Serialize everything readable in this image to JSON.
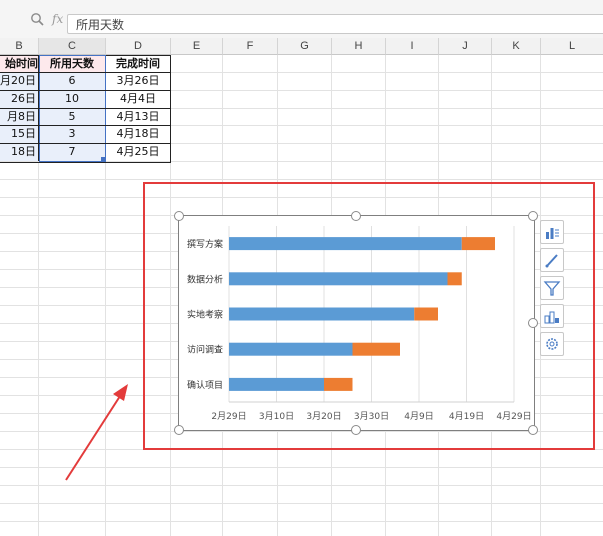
{
  "formula_bar": {
    "fx_label": "fx",
    "content": "所用天数"
  },
  "columns": [
    "B",
    "C",
    "D",
    "E",
    "F",
    "G",
    "H",
    "I",
    "J",
    "K",
    "L"
  ],
  "table": {
    "headers": [
      "始时间",
      "所用天数",
      "完成时间"
    ],
    "rows": [
      [
        "月20日",
        "6",
        "3月26日"
      ],
      [
        "26日",
        "10",
        "4月4日"
      ],
      [
        "月8日",
        "5",
        "4月13日"
      ],
      [
        "15日",
        "3",
        "4月18日"
      ],
      [
        "18日",
        "7",
        "4月25日"
      ]
    ]
  },
  "colors": {
    "start_series": "#5b9bd5",
    "duration_series": "#ed7d31",
    "highlight": "#e33b3b"
  },
  "chart_data": {
    "type": "bar",
    "orientation": "horizontal",
    "stacked": true,
    "categories": [
      "撰写方案",
      "数据分析",
      "实地考察",
      "访问调查",
      "确认项目"
    ],
    "series": [
      {
        "values": [
          "4月18日",
          "4月15日",
          "4月8日",
          "3月26日",
          "3月20日"
        ]
      },
      {
        "values": [
          7,
          3,
          5,
          10,
          6
        ]
      }
    ],
    "x_ticks": [
      "2月29日",
      "3月10日",
      "3月20日",
      "3月30日",
      "4月9日",
      "4月19日",
      "4月29日"
    ],
    "x_range": [
      "2月29日",
      "4月29日"
    ],
    "grid": "vertical",
    "legend": "none"
  },
  "chart_tools": [
    "chart-elements-icon",
    "chart-style-icon",
    "chart-filter-icon",
    "chart-type-icon",
    "chart-settings-icon"
  ]
}
